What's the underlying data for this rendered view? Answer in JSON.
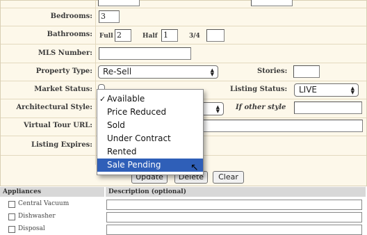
{
  "form": {
    "bedrooms": {
      "label": "Bedrooms:",
      "value": "3"
    },
    "bathrooms": {
      "label": "Bathrooms:",
      "full_label": "Full",
      "full_value": "2",
      "half_label": "Half",
      "half_value": "1",
      "threequarter_label": "3/4",
      "threequarter_value": ""
    },
    "mls": {
      "label": "MLS Number:",
      "value": ""
    },
    "property_type": {
      "label": "Property Type:",
      "value": "Re-Sell"
    },
    "stories": {
      "label": "Stories:",
      "value": ""
    },
    "market_status": {
      "label": "Market Status:"
    },
    "listing_status": {
      "label": "Listing Status:",
      "value": "LIVE"
    },
    "architectural_style": {
      "label": "Architectural Style:"
    },
    "other_style": {
      "label": "If other style",
      "value": ""
    },
    "virtual_tour": {
      "label": "Virtual Tour URL:",
      "value": ""
    },
    "listing_expires": {
      "label": "Listing Expires:",
      "value": ""
    }
  },
  "dropdown": {
    "selected_index": 0,
    "highlighted_index": 5,
    "options": [
      "Available",
      "Price Reduced",
      "Sold",
      "Under Contract",
      "Rented",
      "Sale Pending"
    ]
  },
  "buttons": {
    "update": "Update",
    "delete": "Delete",
    "clear": "Clear"
  },
  "appliances": {
    "col_appliances": "Appliances",
    "col_description": "Description (optional)",
    "items": [
      "Central Vacuum",
      "Dishwasher",
      "Disposal"
    ]
  },
  "colors": {
    "panel_bg": "#fdf8ea",
    "highlight": "#2f5fb8",
    "header_bg": "#d8d8d8"
  }
}
